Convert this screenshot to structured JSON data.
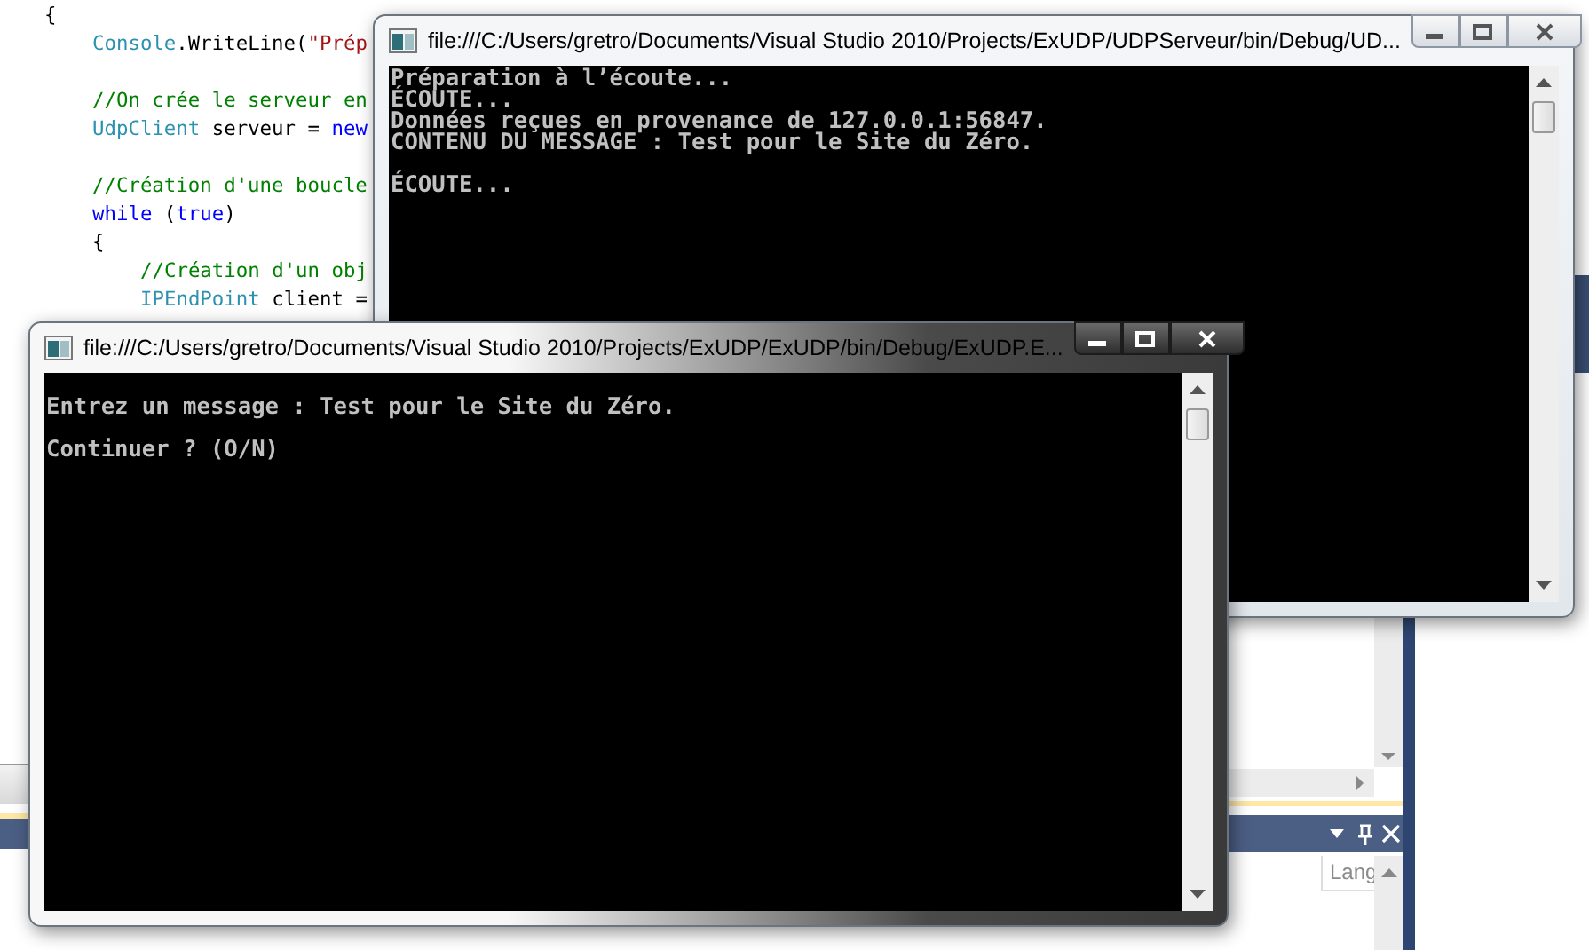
{
  "editor": {
    "lines": [
      {
        "kind": "code",
        "tokens": [
          {
            "kind": "plain",
            "text": "{"
          }
        ],
        "children": [
          {
            "kind": "code",
            "tokens": [
              {
                "kind": "type",
                "text": "Console"
              },
              {
                "kind": "plain",
                "text": ".WriteLine("
              },
              {
                "kind": "string",
                "text": "\"Prép"
              }
            ]
          },
          {
            "kind": "blank"
          },
          {
            "kind": "code",
            "tokens": [
              {
                "kind": "comment",
                "text": "//On crée le serveur en"
              }
            ]
          },
          {
            "kind": "code",
            "tokens": [
              {
                "kind": "type",
                "text": "UdpClient"
              },
              {
                "kind": "plain",
                "text": " serveur = "
              },
              {
                "kind": "keyword",
                "text": "new"
              }
            ]
          },
          {
            "kind": "blank"
          },
          {
            "kind": "code",
            "tokens": [
              {
                "kind": "comment",
                "text": "//Création d'une boucle"
              }
            ]
          },
          {
            "kind": "code",
            "tokens": [
              {
                "kind": "keyword",
                "text": "while"
              },
              {
                "kind": "plain",
                "text": " ("
              },
              {
                "kind": "keyword",
                "text": "true"
              },
              {
                "kind": "plain",
                "text": ")"
              }
            ]
          },
          {
            "kind": "code",
            "tokens": [
              {
                "kind": "plain",
                "text": "{"
              }
            ],
            "children": [
              {
                "kind": "code",
                "tokens": [
                  {
                    "kind": "comment",
                    "text": "//Création d'un obj"
                  }
                ]
              },
              {
                "kind": "code",
                "tokens": [
                  {
                    "kind": "type",
                    "text": "IPEndPoint"
                  },
                  {
                    "kind": "plain",
                    "text": " client ="
                  }
                ]
              }
            ]
          }
        ]
      }
    ]
  },
  "windows": [
    {
      "title": "file:///C:/Users/gretro/Documents/Visual Studio 2010/Projects/ExUDP/UDPServeur/bin/Debug/UD...",
      "active": false,
      "lines": [
        {
          "kind": "text",
          "text": "Préparation à l’écoute..."
        },
        {
          "kind": "text",
          "text": "ÉCOUTE..."
        },
        {
          "kind": "text",
          "text": "Données reçues en provenance de 127.0.0.1:56847."
        },
        {
          "kind": "text",
          "text": "CONTENU DU MESSAGE : Test pour le Site du Zéro."
        },
        {
          "kind": "blank"
        },
        {
          "kind": "text",
          "text": "ÉCOUTE..."
        }
      ]
    },
    {
      "title": "file:///C:/Users/gretro/Documents/Visual Studio 2010/Projects/ExUDP/ExUDP/bin/Debug/ExUDP.E...",
      "active": true,
      "lines": [
        {
          "kind": "blank"
        },
        {
          "kind": "text",
          "text": "Entrez un message : Test pour le Site du Zéro."
        },
        {
          "kind": "blank"
        },
        {
          "kind": "text",
          "text": "Continuer ? (O/N)"
        }
      ]
    }
  ],
  "bottom_panel": {
    "column_header": "Lang"
  }
}
